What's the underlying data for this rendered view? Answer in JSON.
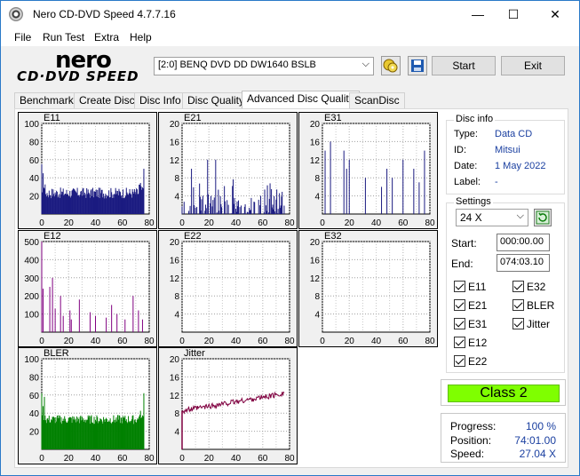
{
  "window": {
    "title": "Nero CD-DVD Speed 4.7.7.16",
    "minimize_glyph": "—",
    "maximize_glyph": "☐",
    "close_glyph": "✕"
  },
  "menu": [
    "File",
    "Run Test",
    "Extra",
    "Help"
  ],
  "logo": {
    "top": "nero",
    "bottom": "CD·DVD SPEED"
  },
  "toolbar": {
    "drive": "[2:0]   BENQ DVD DD DW1640 BSLB",
    "start_label": "Start",
    "exit_label": "Exit"
  },
  "tabs": [
    "Benchmark",
    "Create Disc",
    "Disc Info",
    "Disc Quality",
    "Advanced Disc Quality",
    "ScanDisc"
  ],
  "active_tab": "Advanced Disc Quality",
  "disc_info": {
    "title": "Disc info",
    "type_label": "Type:",
    "type": "Data CD",
    "id_label": "ID:",
    "id": "Mitsui",
    "date_label": "Date:",
    "date": "1 May 2022",
    "label_label": "Label:",
    "label": "-"
  },
  "settings": {
    "title": "Settings",
    "speed": "24 X",
    "start_label": "Start:",
    "start": "000:00.00",
    "end_label": "End:",
    "end": "074:03.10",
    "checks": [
      "E11",
      "E32",
      "E21",
      "BLER",
      "E31",
      "Jitter",
      "E12",
      "E22"
    ]
  },
  "result": {
    "class": "Class 2"
  },
  "progress": {
    "progress_label": "Progress:",
    "progress": "100 %",
    "position_label": "Position:",
    "position": "74:01.00",
    "speed_label": "Speed:",
    "speed": "27.04 X"
  },
  "colors": {
    "navy": "#1a1a80",
    "purple": "#800080",
    "green": "#008000",
    "maroon": "#800040"
  },
  "chart_data": [
    {
      "type": "bar",
      "title": "E11",
      "x_ticks": [
        0,
        20,
        40,
        60,
        80
      ],
      "y_ticks": [
        20,
        40,
        60,
        80,
        100
      ],
      "ylim": [
        0,
        100
      ],
      "xlim": [
        0,
        80
      ],
      "color": "#1a1a80",
      "profile": "dense",
      "base": 22,
      "var": 12,
      "spikes": [
        [
          0,
          55
        ],
        [
          1,
          45
        ],
        [
          76,
          50
        ]
      ]
    },
    {
      "type": "bar",
      "title": "E21",
      "x_ticks": [
        0,
        20,
        40,
        60,
        80
      ],
      "y_ticks": [
        4,
        8,
        12,
        16,
        20
      ],
      "ylim": [
        0,
        20
      ],
      "xlim": [
        0,
        80
      ],
      "color": "#1a1a80",
      "profile": "sparse",
      "base": 2,
      "var": 4,
      "spikes": [
        [
          25,
          12
        ],
        [
          7,
          10
        ],
        [
          19,
          12
        ]
      ]
    },
    {
      "type": "bar",
      "title": "E31",
      "x_ticks": [
        0,
        20,
        40,
        60,
        80
      ],
      "y_ticks": [
        4,
        8,
        12,
        16,
        20
      ],
      "ylim": [
        0,
        20
      ],
      "xlim": [
        0,
        80
      ],
      "color": "#1a1a80",
      "profile": "spiky",
      "base": 0,
      "var": 0,
      "spikes": [
        [
          2,
          14
        ],
        [
          6,
          16
        ],
        [
          16,
          14
        ],
        [
          18,
          10
        ],
        [
          20,
          12
        ],
        [
          32,
          8
        ],
        [
          44,
          6
        ],
        [
          48,
          10
        ],
        [
          52,
          8
        ],
        [
          60,
          12
        ],
        [
          68,
          10
        ],
        [
          72,
          7
        ],
        [
          76,
          14
        ]
      ]
    },
    {
      "type": "bar",
      "title": "E12",
      "x_ticks": [
        0,
        20,
        40,
        60,
        80
      ],
      "y_ticks": [
        100,
        200,
        300,
        400,
        500
      ],
      "ylim": [
        0,
        500
      ],
      "xlim": [
        0,
        80
      ],
      "color": "#800080",
      "profile": "spiky",
      "base": 0,
      "var": 0,
      "spikes": [
        [
          0,
          500
        ],
        [
          1,
          240
        ],
        [
          6,
          250
        ],
        [
          8,
          300
        ],
        [
          10,
          130
        ],
        [
          14,
          200
        ],
        [
          16,
          90
        ],
        [
          21,
          120
        ],
        [
          22,
          70
        ],
        [
          28,
          180
        ],
        [
          36,
          110
        ],
        [
          40,
          90
        ],
        [
          48,
          80
        ],
        [
          52,
          150
        ],
        [
          56,
          100
        ],
        [
          62,
          70
        ],
        [
          68,
          200
        ],
        [
          72,
          120
        ],
        [
          75,
          70
        ]
      ]
    },
    {
      "type": "bar",
      "title": "E22",
      "x_ticks": [
        0,
        20,
        40,
        60,
        80
      ],
      "y_ticks": [
        4,
        8,
        12,
        16,
        20
      ],
      "ylim": [
        0,
        20
      ],
      "xlim": [
        0,
        80
      ],
      "color": "#1a1a80",
      "profile": "empty",
      "base": 0,
      "var": 0,
      "spikes": []
    },
    {
      "type": "bar",
      "title": "E32",
      "x_ticks": [
        0,
        20,
        40,
        60,
        80
      ],
      "y_ticks": [
        4,
        8,
        12,
        16,
        20
      ],
      "ylim": [
        0,
        20
      ],
      "xlim": [
        0,
        80
      ],
      "color": "#1a1a80",
      "profile": "empty",
      "base": 0,
      "var": 0,
      "spikes": []
    },
    {
      "type": "bar",
      "title": "BLER",
      "x_ticks": [
        0,
        20,
        40,
        60,
        80
      ],
      "y_ticks": [
        20,
        40,
        60,
        80,
        100
      ],
      "ylim": [
        0,
        100
      ],
      "xlim": [
        0,
        80
      ],
      "color": "#008000",
      "profile": "dense",
      "base": 32,
      "var": 10,
      "spikes": [
        [
          0,
          62
        ],
        [
          2,
          58
        ],
        [
          76,
          62
        ]
      ]
    },
    {
      "type": "line",
      "title": "Jitter",
      "x_ticks": [
        0,
        20,
        40,
        60,
        80
      ],
      "y_ticks": [
        4,
        8,
        12,
        16,
        20
      ],
      "ylim": [
        0,
        20
      ],
      "xlim": [
        0,
        80
      ],
      "color": "#800040",
      "x": [
        0,
        10,
        20,
        30,
        40,
        50,
        60,
        70,
        76
      ],
      "y": [
        8.5,
        9,
        9.5,
        10,
        10.5,
        11,
        11.5,
        12,
        12.5
      ]
    }
  ]
}
